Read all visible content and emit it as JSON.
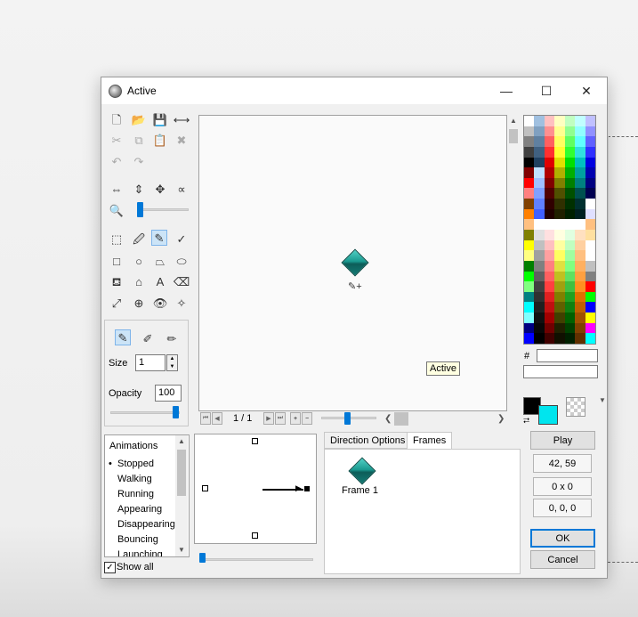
{
  "window": {
    "title": "Active",
    "minimize": "—",
    "maximize": "☐",
    "close": "✕"
  },
  "toolbar": {
    "size_label": "Size",
    "size_value": "1",
    "opacity_label": "Opacity",
    "opacity_value": "100"
  },
  "canvas": {
    "frame_counter": "1 / 1",
    "tooltip": "Active"
  },
  "animations": {
    "header": "Animations",
    "items": [
      "Stopped",
      "Walking",
      "Running",
      "Appearing",
      "Disappearing",
      "Bouncing",
      "Launching"
    ],
    "selected": "Stopped",
    "show_all_label": "Show all",
    "show_all_checked": true
  },
  "tabs": [
    {
      "label": "Direction Options",
      "active": false
    },
    {
      "label": "Frames",
      "active": true
    }
  ],
  "frames": [
    {
      "label": "Frame 1"
    }
  ],
  "right_panel": {
    "hash_label": "#",
    "hex_value": "",
    "play_label": "Play",
    "coords": "42, 59",
    "size": "0 x 0",
    "rgb": "0, 0, 0",
    "ok_label": "OK",
    "cancel_label": "Cancel"
  },
  "colors": {
    "foreground": "#000000",
    "background": "#00e5ee",
    "accent": "#0078d7"
  }
}
